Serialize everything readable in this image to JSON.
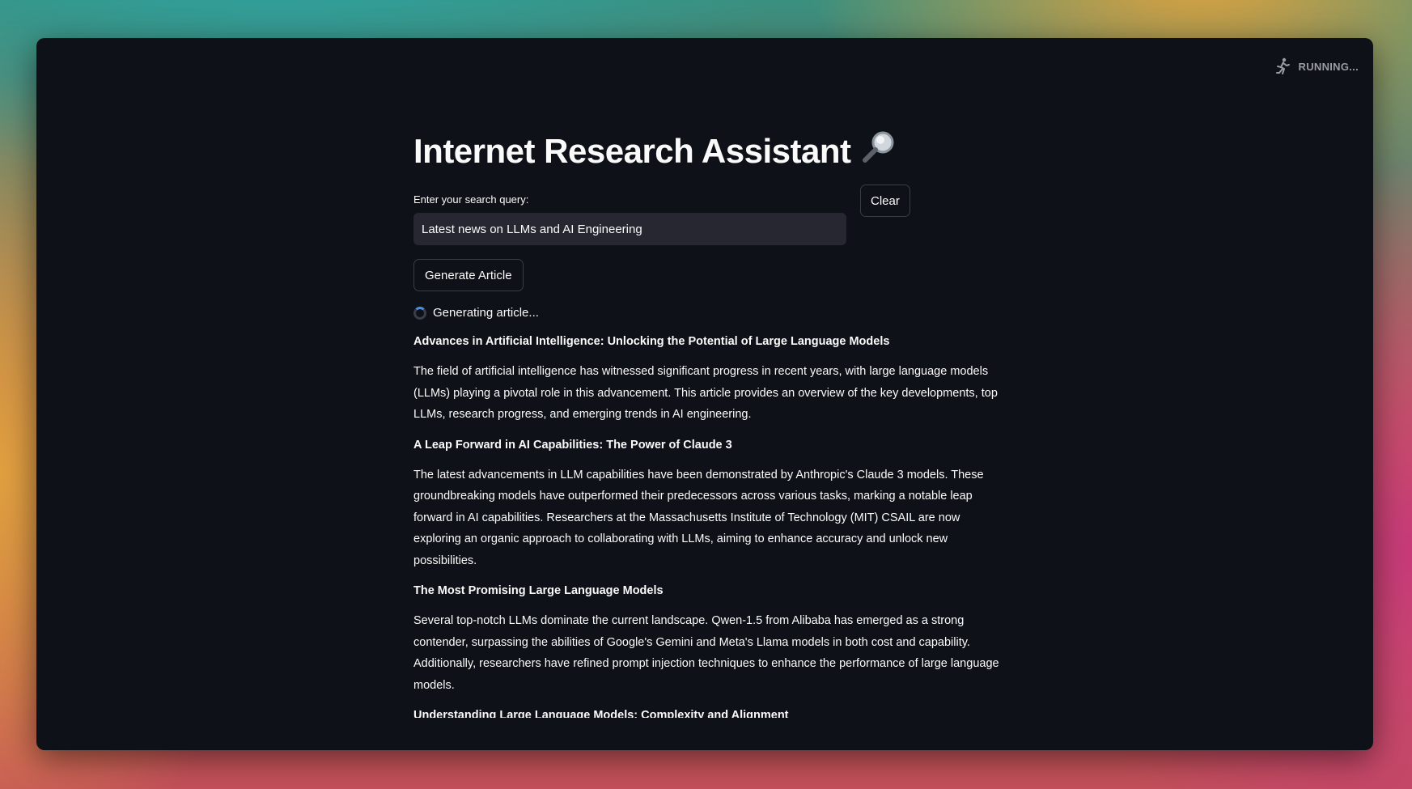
{
  "status": {
    "label": "RUNNING...",
    "icon": "running-man-icon"
  },
  "app": {
    "title": "Internet Research Assistant",
    "title_icon": "magnifying-glass-icon"
  },
  "search": {
    "label": "Enter your search query:",
    "value": "Latest news on LLMs and AI Engineering"
  },
  "buttons": {
    "clear": "Clear",
    "generate": "Generate Article"
  },
  "progress": {
    "text": "Generating article..."
  },
  "article": {
    "sections": [
      {
        "heading": "Advances in Artificial Intelligence: Unlocking the Potential of Large Language Models",
        "body": "The field of artificial intelligence has witnessed significant progress in recent years, with large language models (LLMs) playing a pivotal role in this advancement. This article provides an overview of the key developments, top LLMs, research progress, and emerging trends in AI engineering."
      },
      {
        "heading": "A Leap Forward in AI Capabilities: The Power of Claude 3",
        "body": "The latest advancements in LLM capabilities have been demonstrated by Anthropic's Claude 3 models. These groundbreaking models have outperformed their predecessors across various tasks, marking a notable leap forward in AI capabilities. Researchers at the Massachusetts Institute of Technology (MIT) CSAIL are now exploring an organic approach to collaborating with LLMs, aiming to enhance accuracy and unlock new possibilities."
      },
      {
        "heading": "The Most Promising Large Language Models",
        "body": "Several top-notch LLMs dominate the current landscape. Qwen-1.5 from Alibaba has emerged as a strong contender, surpassing the abilities of Google's Gemini and Meta's Llama models in both cost and capability. Additionally, researchers have refined prompt injection techniques to enhance the performance of large language models."
      }
    ],
    "next_heading": "Understanding Large Language Models: Complexity and Alignment"
  },
  "colors": {
    "background": "#0e1117",
    "input_bg": "#262730",
    "spinner_accent": "#4a90e2"
  }
}
